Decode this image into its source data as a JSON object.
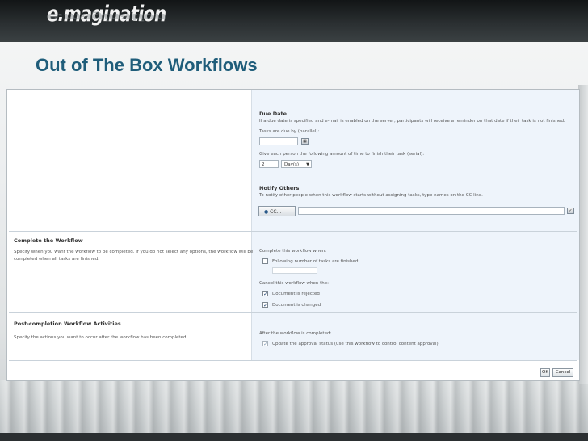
{
  "brand": {
    "logo": "e.magination"
  },
  "slide": {
    "title": "Out of The Box Workflows"
  },
  "form": {
    "due_date": {
      "heading": "Due Date",
      "description": "If a due date is specified and e-mail is enabled on the server, participants will receive a reminder on that date if their task is not finished.",
      "parallel_label": "Tasks are due by (parallel):",
      "serial_label": "Give each person the following amount of time to finish their task (serial):",
      "serial_value": "2",
      "serial_unit": "Day(s)"
    },
    "notify_others": {
      "heading": "Notify Others",
      "description": "To notify other people when this workflow starts without assigning tasks, type names on the CC line.",
      "cc_button": "CC..."
    },
    "complete": {
      "heading": "Complete the Workflow",
      "description_1": "Specify when you want the workflow to be completed. If you do not select any options, the workflow will be",
      "description_2": "completed when all tasks are finished.",
      "when_label": "Complete this workflow when:",
      "tasks_finished_label": "Following number of tasks are finished:",
      "cancel_label": "Cancel this workflow when the:",
      "rejected_label": "Document is rejected",
      "rejected_checked": true,
      "changed_label": "Document is changed",
      "changed_checked": true
    },
    "post_completion": {
      "heading": "Post-completion Workflow Activities",
      "description": "Specify the actions you want to occur after the workflow has been completed.",
      "after_label": "After the workflow is completed:",
      "update_label": "Update the approval status (use this workflow to control content approval)",
      "update_checked": true
    },
    "buttons": {
      "ok": "OK",
      "cancel": "Cancel"
    }
  }
}
